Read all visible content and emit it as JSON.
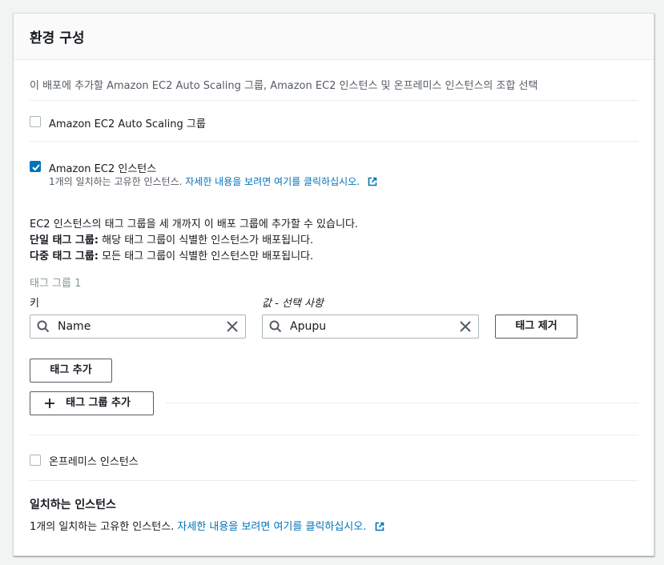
{
  "panel": {
    "title": "환경 구성",
    "description": "이 배포에 추가할 Amazon EC2 Auto Scaling 그룹, Amazon EC2 인스턴스 및 온프레미스 인스턴스의 조합 선택"
  },
  "options": {
    "asg": {
      "label": "Amazon EC2 Auto Scaling 그룹",
      "checked": false
    },
    "ec2": {
      "label": "Amazon EC2 인스턴스",
      "checked": true,
      "match_text": "1개의 일치하는 고유한 인스턴스.",
      "link_text": "자세한 내용을 보려면 여기를 클릭하십시오."
    },
    "onprem": {
      "label": "온프레미스 인스턴스",
      "checked": false
    }
  },
  "tag_info": {
    "line1": "EC2 인스턴스의 태그 그룹을 세 개까지 이 배포 그룹에 추가할 수 있습니다.",
    "single_label": "단일 태그 그룹:",
    "single_text": " 해당 태그 그룹이 식별한 인스턴스가 배포됩니다.",
    "multi_label": "다중 태그 그룹:",
    "multi_text": " 모든 태그 그룹이 식별한 인스턴스만 배포됩니다."
  },
  "tag_group": {
    "title": "태그 그룹 1",
    "key_label": "키",
    "value_label": "값 - 선택 사항",
    "key_value": "Name",
    "value_value": "Apupu",
    "remove_tag": "태그 제거",
    "add_tag": "태그 추가",
    "add_group": "태그 그룹 추가"
  },
  "matching": {
    "title": "일치하는 인스턴스",
    "text": "1개의 일치하는 고유한 인스턴스.",
    "link_text": "자세한 내용을 보려면 여기를 클릭하십시오."
  },
  "colors": {
    "accent": "#0073bb",
    "border": "#aab7b8",
    "text": "#16191f",
    "muted": "#545b64"
  },
  "icons": [
    "search-icon",
    "close-icon",
    "external-link-icon",
    "plus-icon",
    "check-icon"
  ]
}
